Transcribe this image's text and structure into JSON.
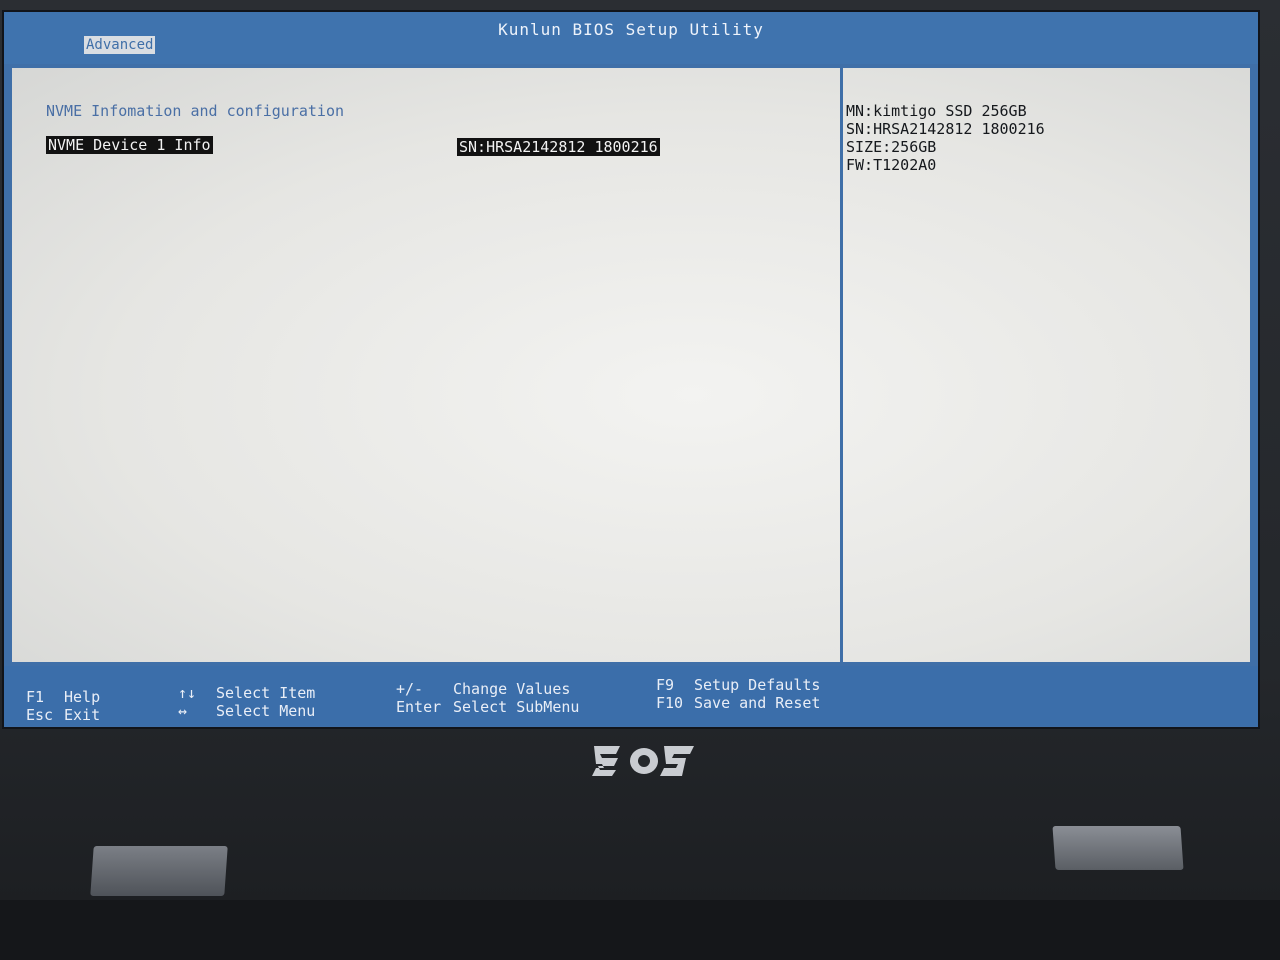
{
  "window": {
    "title": "Kunlun BIOS Setup Utility",
    "active_tab": "Advanced"
  },
  "main": {
    "section_title": "NVME Infomation and configuration",
    "item_label": "NVME Device 1 Info",
    "item_value": "SN:HRSA2142812 1800216"
  },
  "info_panel": {
    "mn": "MN:kimtigo SSD 256GB",
    "sn": "SN:HRSA2142812 1800216",
    "size": "SIZE:256GB",
    "fw": "FW:T1202A0"
  },
  "help": {
    "f1_key": "F1",
    "f1_label": "Help",
    "esc_key": "Esc",
    "esc_label": "Exit",
    "updown_key": "↑↓",
    "updown_label": "Select Item",
    "leftright_key": "↔",
    "leftright_label": "Select Menu",
    "plusminus_key": "+/-",
    "plusminus_label": "Change Values",
    "enter_key": "Enter",
    "enter_label": "Select SubMenu",
    "f9_key": "F9",
    "f9_label": "Setup Defaults",
    "f10_key": "F10",
    "f10_label": "Save and Reset"
  },
  "colors": {
    "bios_blue": "#3f6fa8",
    "panel_bg": "#ececea",
    "highlight": "#121212"
  }
}
